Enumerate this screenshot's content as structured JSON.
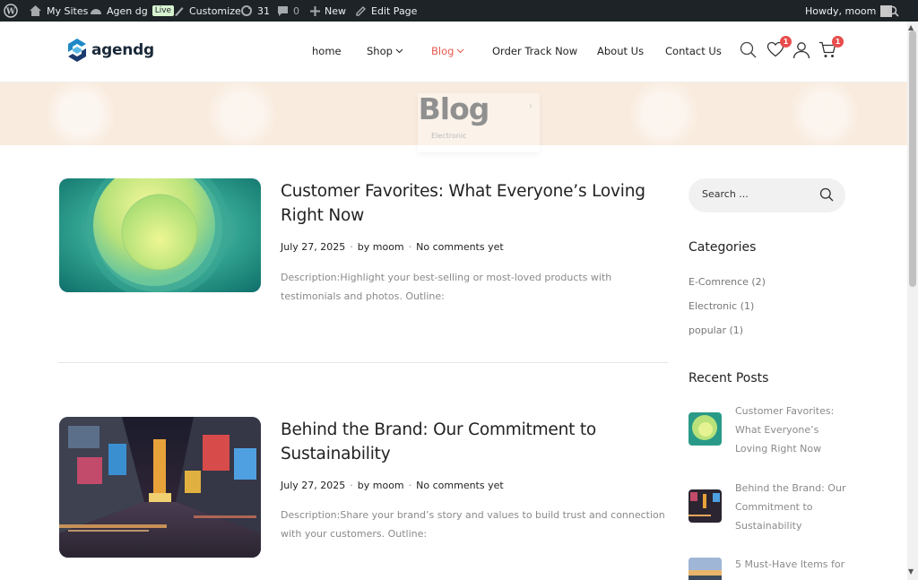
{
  "adminbar": {
    "my_sites": "My Sites",
    "site_name": "Agen dg",
    "live_badge": "Live",
    "customize": "Customize",
    "updates_count": "31",
    "comments_count": "0",
    "new": "New",
    "edit_page": "Edit Page",
    "greeting": "Howdy, moom"
  },
  "header": {
    "logo_text": "agendg",
    "nav": [
      {
        "label": "home"
      },
      {
        "label": "Shop"
      },
      {
        "label": "Blog"
      },
      {
        "label": "Order Track Now"
      },
      {
        "label": "About Us"
      },
      {
        "label": "Contact Us"
      }
    ],
    "wishlist_count": "1",
    "cart_count": "1"
  },
  "banner": {
    "title": "Blog",
    "ghost_label": "Electronic"
  },
  "posts": [
    {
      "title": "Customer Favorites: What Everyone’s Loving Right Now",
      "date": "July 27, 2025",
      "author": "by moom",
      "comments": "No comments yet",
      "description": "Description:Highlight your best-selling or most-loved products with testimonials and photos. Outline:"
    },
    {
      "title": "Behind the Brand: Our Commitment to Sustainability",
      "date": "July 27, 2025",
      "author": "by moom",
      "comments": "No comments yet",
      "description": "Description:Share your brand’s story and values to build trust and connection with your customers. Outline:"
    }
  ],
  "sidebar": {
    "search_placeholder": "Search ...",
    "categories_heading": "Categories",
    "categories": [
      {
        "label": "E-Comrence (2)"
      },
      {
        "label": "Electronic (1)"
      },
      {
        "label": "popular (1)"
      }
    ],
    "recent_heading": "Recent Posts",
    "recent_posts": [
      {
        "title": "Customer Favorites: What Everyone’s Loving Right Now"
      },
      {
        "title": "Behind the Brand: Our Commitment to Sustainability"
      },
      {
        "title": "5 Must-Have Items for"
      }
    ]
  },
  "colors": {
    "accent": "#e85a4f",
    "badge": "#e84d4d",
    "banner_bg": "#f9ebde",
    "adminbar_bg": "#1d2327"
  }
}
